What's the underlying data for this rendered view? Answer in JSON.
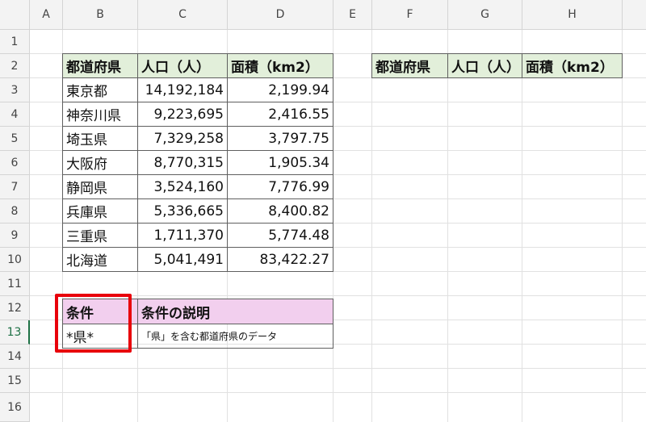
{
  "columns": [
    "A",
    "B",
    "C",
    "D",
    "E",
    "F",
    "G",
    "H"
  ],
  "rows": [
    "1",
    "2",
    "3",
    "4",
    "5",
    "6",
    "7",
    "8",
    "9",
    "10",
    "11",
    "12",
    "13",
    "14",
    "15",
    "16"
  ],
  "table": {
    "headers": [
      "都道府県",
      "人口（人）",
      "面積（km2）"
    ],
    "rows": [
      {
        "pref": "東京都",
        "pop": "14,192,184",
        "area": "2,199.94"
      },
      {
        "pref": "神奈川県",
        "pop": "9,223,695",
        "area": "2,416.55"
      },
      {
        "pref": "埼玉県",
        "pop": "7,329,258",
        "area": "3,797.75"
      },
      {
        "pref": "大阪府",
        "pop": "8,770,315",
        "area": "1,905.34"
      },
      {
        "pref": "静岡県",
        "pop": "3,524,160",
        "area": "7,776.99"
      },
      {
        "pref": "兵庫県",
        "pop": "5,336,665",
        "area": "8,400.82"
      },
      {
        "pref": "三重県",
        "pop": "1,711,370",
        "area": "5,774.48"
      },
      {
        "pref": "北海道",
        "pop": "5,041,491",
        "area": "83,422.27"
      }
    ]
  },
  "result_headers": [
    "都道府県",
    "人口（人）",
    "面積（km2）"
  ],
  "condition": {
    "header": "条件",
    "desc_header": "条件の説明",
    "value": "*県*",
    "description": "「県」を含む都道府県のデータ"
  },
  "colors": {
    "header_green": "#e2efda",
    "header_pink": "#f2cfee",
    "highlight_red": "#e8000b",
    "active_row": "#1e7145"
  }
}
